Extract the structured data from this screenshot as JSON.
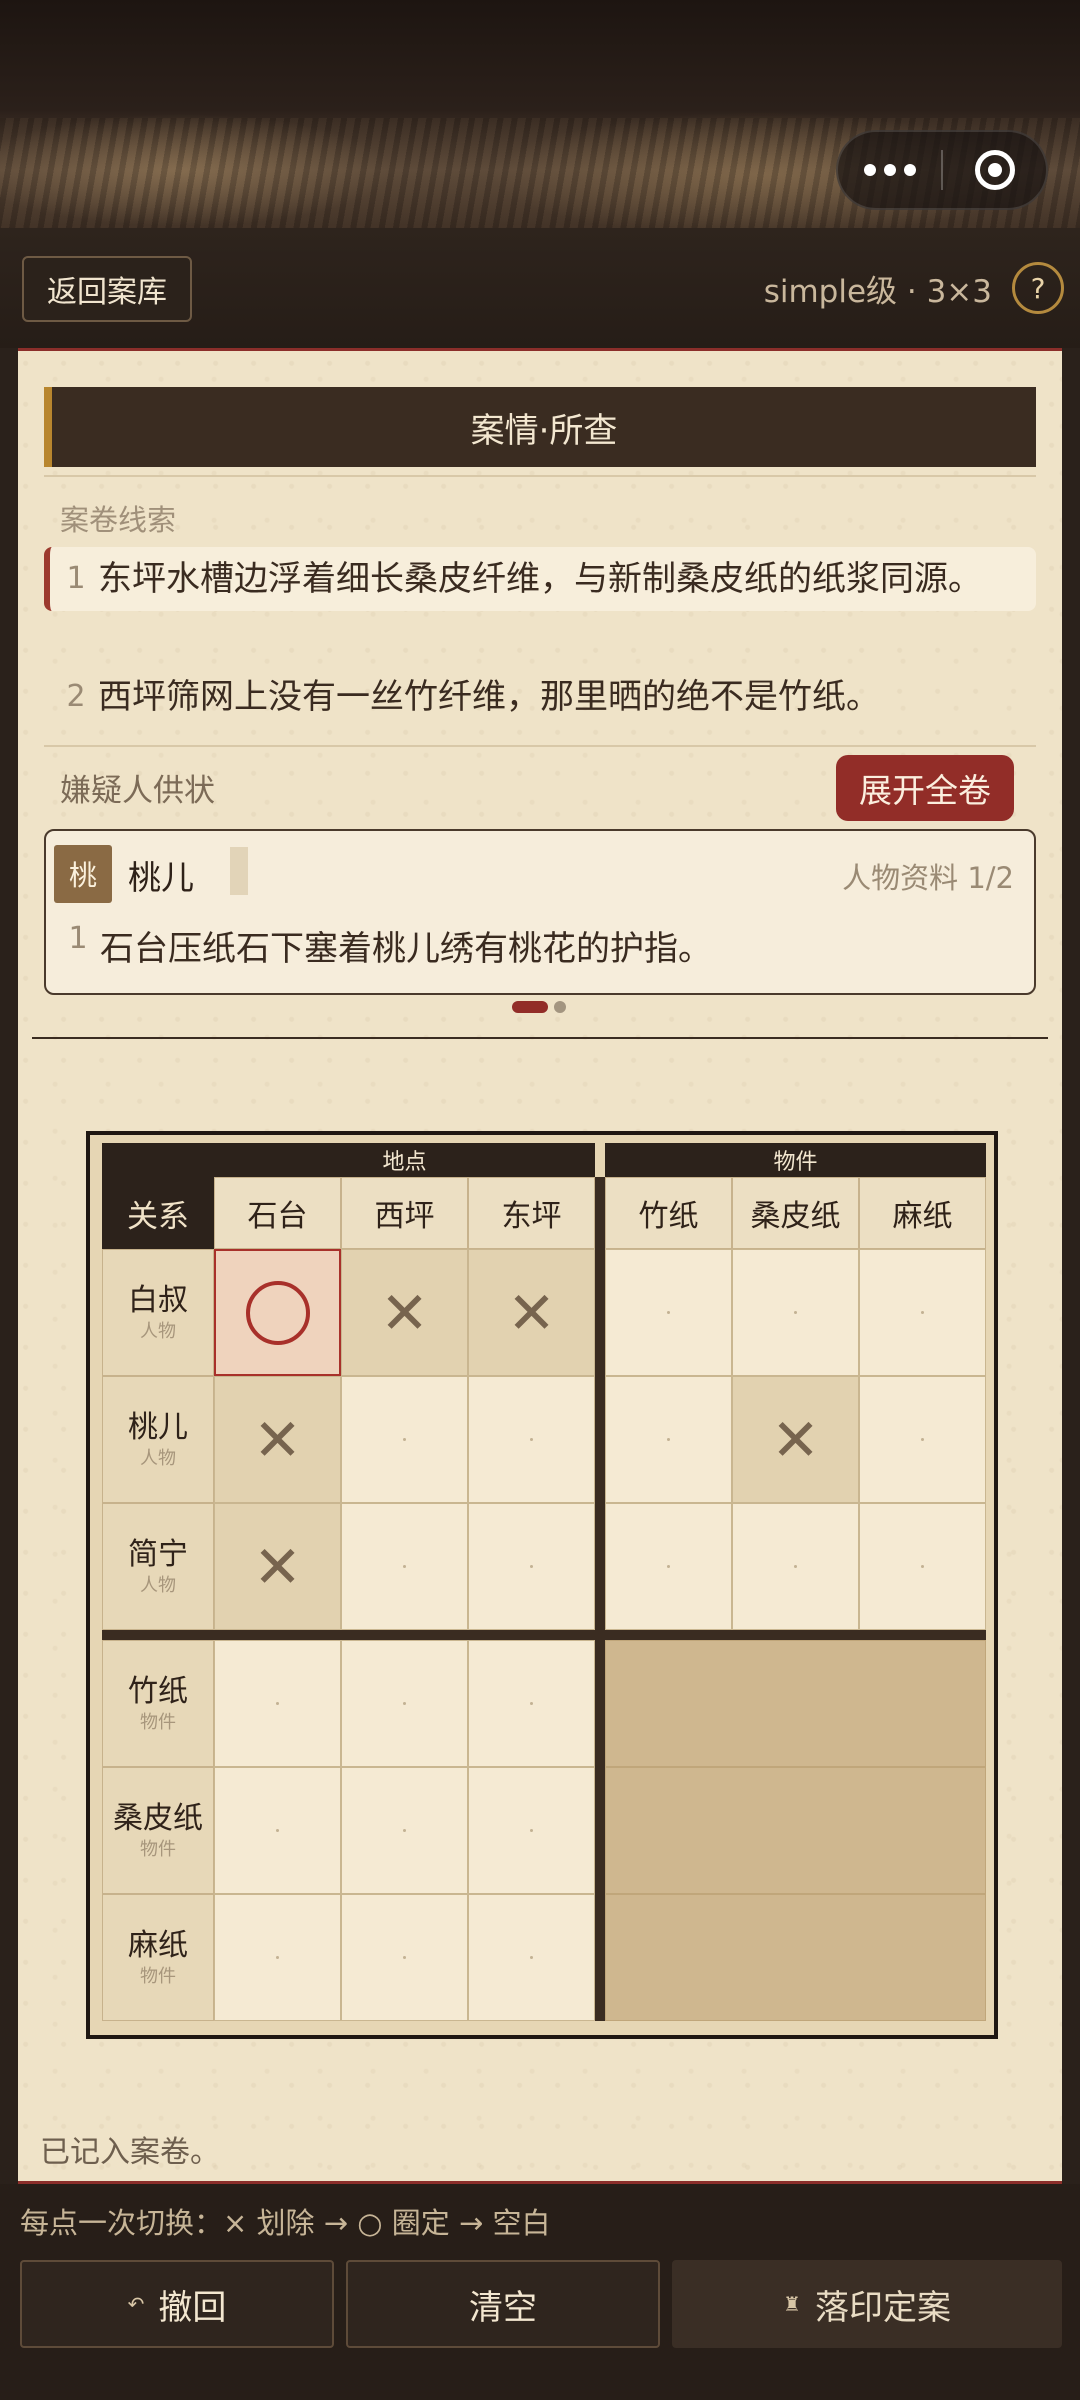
{
  "top_bar": {
    "more_icon": "more-dots-icon",
    "close_icon": "target-circle-icon"
  },
  "header": {
    "back_label": "返回案库",
    "level_label": "simple级 · 3×3",
    "help_label": "?"
  },
  "case": {
    "title": "案情·所查",
    "clues_title": "案卷线索",
    "clues": [
      {
        "num": "1",
        "text": "东坪水槽边浮着细长桑皮纤维，与新制桑皮纸的纸浆同源。"
      },
      {
        "num": "2",
        "text": "西坪筛网上没有一丝竹纤维，那里晒的绝不是竹纸。"
      }
    ]
  },
  "suspects": {
    "title": "嫌疑人供状",
    "expand_label": "展开全卷",
    "card": {
      "avatar": "桃",
      "name": "桃儿",
      "page": "人物资料 1/2",
      "statement_num": "1",
      "statement": "石台压纸石下塞着桃儿绣有桃花的护指。"
    }
  },
  "grid": {
    "corner_label": "关系",
    "group_location": "地点",
    "group_item": "物件",
    "locations": [
      "石台",
      "西坪",
      "东坪"
    ],
    "items": [
      "竹纸",
      "桑皮纸",
      "麻纸"
    ],
    "rows": [
      {
        "name": "白叔",
        "type": "人物"
      },
      {
        "name": "桃儿",
        "type": "人物"
      },
      {
        "name": "简宁",
        "type": "人物"
      },
      {
        "name": "竹纸",
        "type": "物件"
      },
      {
        "name": "桑皮纸",
        "type": "物件"
      },
      {
        "name": "麻纸",
        "type": "物件"
      }
    ],
    "marks": {
      "0-0": "o",
      "0-1": "x",
      "0-2": "x",
      "1-0": "x",
      "1-4": "x",
      "2-0": "x"
    },
    "x_symbol": "✕"
  },
  "status_text": "已记入案卷。",
  "bottom": {
    "hint": "每点一次切换：× 划除 → ○ 圈定 → 空白",
    "undo_label": "撤回",
    "clear_label": "清空",
    "seal_label": "落印定案"
  }
}
